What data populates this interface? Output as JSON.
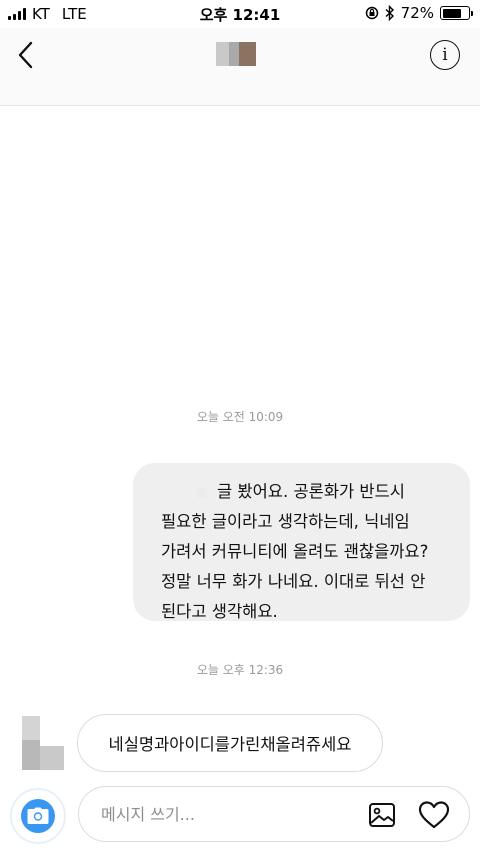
{
  "status_bar": {
    "carrier": "KT",
    "network": "LTE",
    "time": "오후 12:41",
    "battery_percent": "72%",
    "battery_level": 0.72,
    "icons": [
      "signal-icon",
      "orientation-lock-icon",
      "bluetooth-icon",
      "battery-icon"
    ]
  },
  "header": {
    "back_icon": "chevron-left-icon",
    "info_icon": "info-icon",
    "info_glyph": "i"
  },
  "messages": [
    {
      "type": "timestamp",
      "text": "오늘 오전 10:09"
    },
    {
      "type": "outgoing",
      "lines": [
        "글 봤어요. 공론화가 반드시",
        "필요한 글이라고 생각하는데, 닉네임",
        "가려서 커뮤니티에 올려도 괜찮을까요?",
        "정말 너무 화가 나네요. 이대로 뒤선 안",
        "된다고 생각해요."
      ]
    },
    {
      "type": "timestamp",
      "text": "오늘 오후 12:36"
    },
    {
      "type": "incoming",
      "text": "네실명과아이디를가린채올려쥬세요"
    }
  ],
  "composer": {
    "placeholder": "메시지 쓰기...",
    "value": "",
    "camera_icon": "camera-icon",
    "gallery_icon": "gallery-icon",
    "heart_icon": "heart-icon"
  },
  "colors": {
    "accent": "#3897f0",
    "bubble_out_bg": "#efefef",
    "header_bg": "#fafafa",
    "timestamp": "#9a9a9a"
  }
}
